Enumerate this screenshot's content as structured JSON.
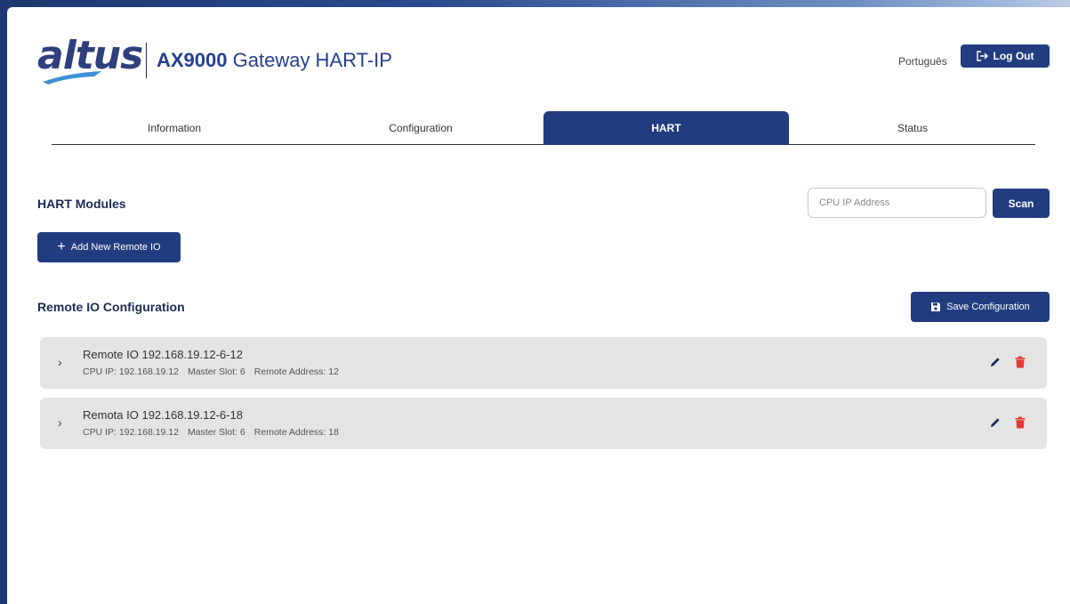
{
  "header": {
    "logo_text": "altus",
    "title_bold": "AX9000",
    "title_rest": " Gateway HART-IP",
    "language": "Português",
    "logout_label": "Log Out"
  },
  "tabs": [
    {
      "label": "Information",
      "active": false
    },
    {
      "label": "Configuration",
      "active": false
    },
    {
      "label": "HART",
      "active": true
    },
    {
      "label": "Status",
      "active": false
    }
  ],
  "modules": {
    "heading": "HART Modules",
    "ip_placeholder": "CPU IP Address",
    "scan_label": "Scan",
    "add_label": "Add New Remote IO"
  },
  "config": {
    "heading": "Remote IO Configuration",
    "save_label": "Save Configuration",
    "items": [
      {
        "title": "Remote IO 192.168.19.12-6-12",
        "cpu_ip": "CPU IP: 192.168.19.12",
        "master_slot": "Master Slot: 6",
        "remote_address": "Remote Address: 12"
      },
      {
        "title": "Remota IO 192.168.19.12-6-18",
        "cpu_ip": "CPU IP: 192.168.19.12",
        "master_slot": "Master Slot: 6",
        "remote_address": "Remote Address: 18"
      }
    ]
  },
  "colors": {
    "primary": "#213d7f",
    "delete_icon": "#e53935",
    "card_bg": "#e4e4e4"
  }
}
